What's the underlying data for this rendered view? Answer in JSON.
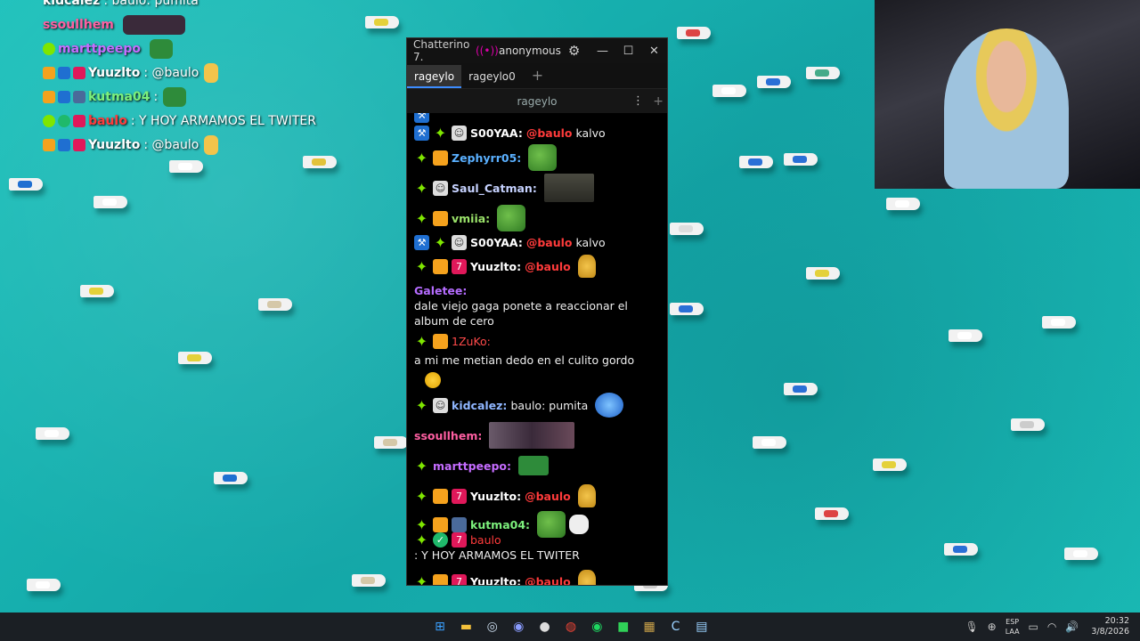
{
  "overlay_chat": [
    {
      "name": "kidcalez",
      "color": "#ffffff",
      "text": "baulo: pumita"
    },
    {
      "name": "ssoullhem",
      "color": "#ff5fa2",
      "text": ""
    },
    {
      "name": "marttpeepo",
      "color": "#c56cff",
      "text": ""
    },
    {
      "name": "Yuuzlto",
      "color": "#ffffff",
      "text": "@baulo"
    },
    {
      "name": "kutma04",
      "color": "#7cf07c",
      "text": ""
    },
    {
      "name": "baulo",
      "color": "#ff3b3b",
      "text": "Y HOY ARMAMOS EL TWITER"
    },
    {
      "name": "Yuuzlto",
      "color": "#ffffff",
      "text": "@baulo"
    }
  ],
  "window": {
    "title": "Chatterino 7.",
    "user": "anonymous",
    "tabs": [
      "rageylo",
      "rageylo0"
    ],
    "channel": "rageylo"
  },
  "messages": [
    {
      "name": "S00YAA:",
      "color": "#ffffff",
      "mention": "@baulo",
      "text": "kalvo"
    },
    {
      "name": "Zephyrr05:",
      "color": "#5ab0ff",
      "mention": "",
      "text": ""
    },
    {
      "name": "Saul_Catman:",
      "color": "#c6d2ff",
      "mention": "",
      "text": ""
    },
    {
      "name": "vmiia:",
      "color": "#9be36a",
      "mention": "",
      "text": ""
    },
    {
      "name": "S00YAA:",
      "color": "#ffffff",
      "mention": "@baulo",
      "text": "kalvo"
    },
    {
      "name": "Yuuzlto:",
      "color": "#ffffff",
      "mention": "@baulo",
      "text": ""
    },
    {
      "name": "Galetee:",
      "color": "#b56cff",
      "mention": "",
      "text": "dale viejo gaga ponete a reaccionar el album de cero"
    },
    {
      "name": "1ZuKo:",
      "color": "#ff4a4a",
      "mention": "",
      "text": "a mi me metian dedo en el culito gordo"
    },
    {
      "name": "kidcalez:",
      "color": "#8fb6ff",
      "mention": "",
      "text": "baulo: pumita"
    },
    {
      "name": "ssoullhem:",
      "color": "#ff5fa2",
      "mention": "",
      "text": ""
    },
    {
      "name": "marttpeepo:",
      "color": "#c56cff",
      "mention": "",
      "text": ""
    },
    {
      "name": "Yuuzlto:",
      "color": "#ffffff",
      "mention": "@baulo",
      "text": ""
    },
    {
      "name": "kutma04:",
      "color": "#7cf07c",
      "mention": "",
      "text": ""
    },
    {
      "name": "baulo",
      "color": "#ff3b3b",
      "mention": "",
      "text": ": Y HOY ARMAMOS EL TWITER"
    },
    {
      "name": "Yuuzlto:",
      "color": "#ffffff",
      "mention": "@baulo",
      "text": ""
    }
  ],
  "tray": {
    "lang_top": "ESP",
    "lang_bottom": "LAA",
    "time": "20:32",
    "date": "3/8/2026"
  }
}
